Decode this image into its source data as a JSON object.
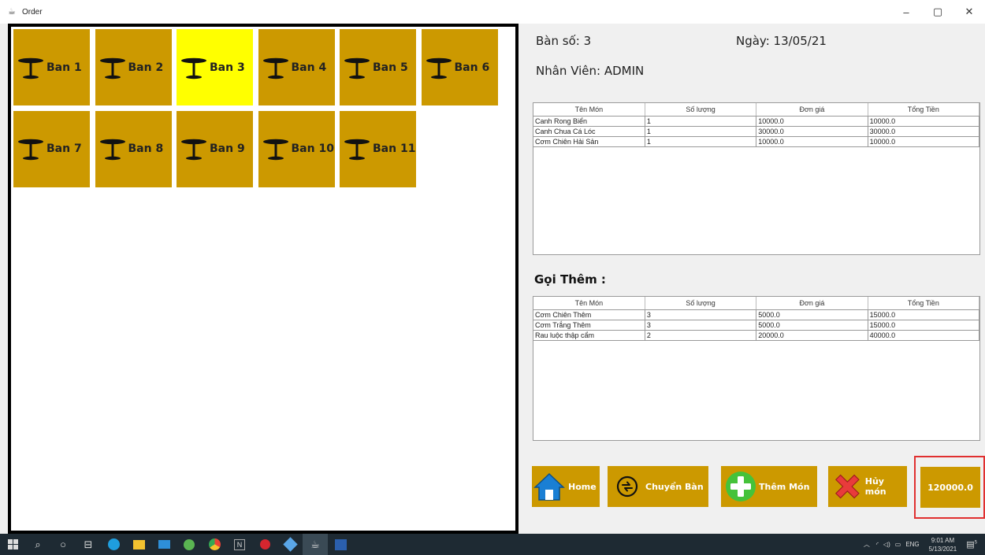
{
  "window": {
    "title": "Order",
    "controls": [
      "–",
      "▢",
      "✕"
    ]
  },
  "tables": [
    {
      "label": "Ban 1",
      "active": false
    },
    {
      "label": "Ban 2",
      "active": false
    },
    {
      "label": "Ban 3",
      "active": true
    },
    {
      "label": "Ban 4",
      "active": false
    },
    {
      "label": "Ban 5",
      "active": false
    },
    {
      "label": "Ban 6",
      "active": false
    },
    {
      "label": "Ban 7",
      "active": false
    },
    {
      "label": "Ban 8",
      "active": false
    },
    {
      "label": "Ban 9",
      "active": false
    },
    {
      "label": "Ban 10",
      "active": false
    },
    {
      "label": "Ban 11",
      "active": false
    }
  ],
  "info": {
    "table_no": "Bàn số:  3",
    "date": "Ngày:  13/05/21",
    "staff": "Nhân Viên:  ADMIN"
  },
  "order_grid": {
    "headers": [
      "Tên Món",
      "Số lượng",
      "Đơn giá",
      "Tổng Tiền"
    ],
    "rows": [
      [
        "Canh Rong Biển",
        "1",
        "10000.0",
        "10000.0"
      ],
      [
        "Canh Chua Cá Lóc",
        "1",
        "30000.0",
        "30000.0"
      ],
      [
        "Cơm Chiên Hải Sản",
        "1",
        "10000.0",
        "10000.0"
      ]
    ]
  },
  "extra_title": "Gọi Thêm :",
  "extra_grid": {
    "headers": [
      "Tên Món",
      "Số lượng",
      "Đơn giá",
      "Tổng Tiền"
    ],
    "rows": [
      [
        "Cơm Chiên Thêm",
        "3",
        "5000.0",
        "15000.0"
      ],
      [
        "Cơm Trắng Thêm",
        "3",
        "5000.0",
        "15000.0"
      ],
      [
        "Rau luộc thập cẩm",
        "2",
        "20000.0",
        "40000.0"
      ]
    ]
  },
  "actions": {
    "home": "Home",
    "move_table": "Chuyển Bàn",
    "add_item": "Thêm Món",
    "cancel_item": "Hủy món",
    "total": "120000.0"
  },
  "taskbar": {
    "time": "9:01 AM",
    "date": "5/13/2021",
    "lang": "ENG",
    "notif_count": "5"
  },
  "colors": {
    "tile": "#cc9900",
    "active_tile": "#ffff00",
    "highlight": "#e03030"
  }
}
